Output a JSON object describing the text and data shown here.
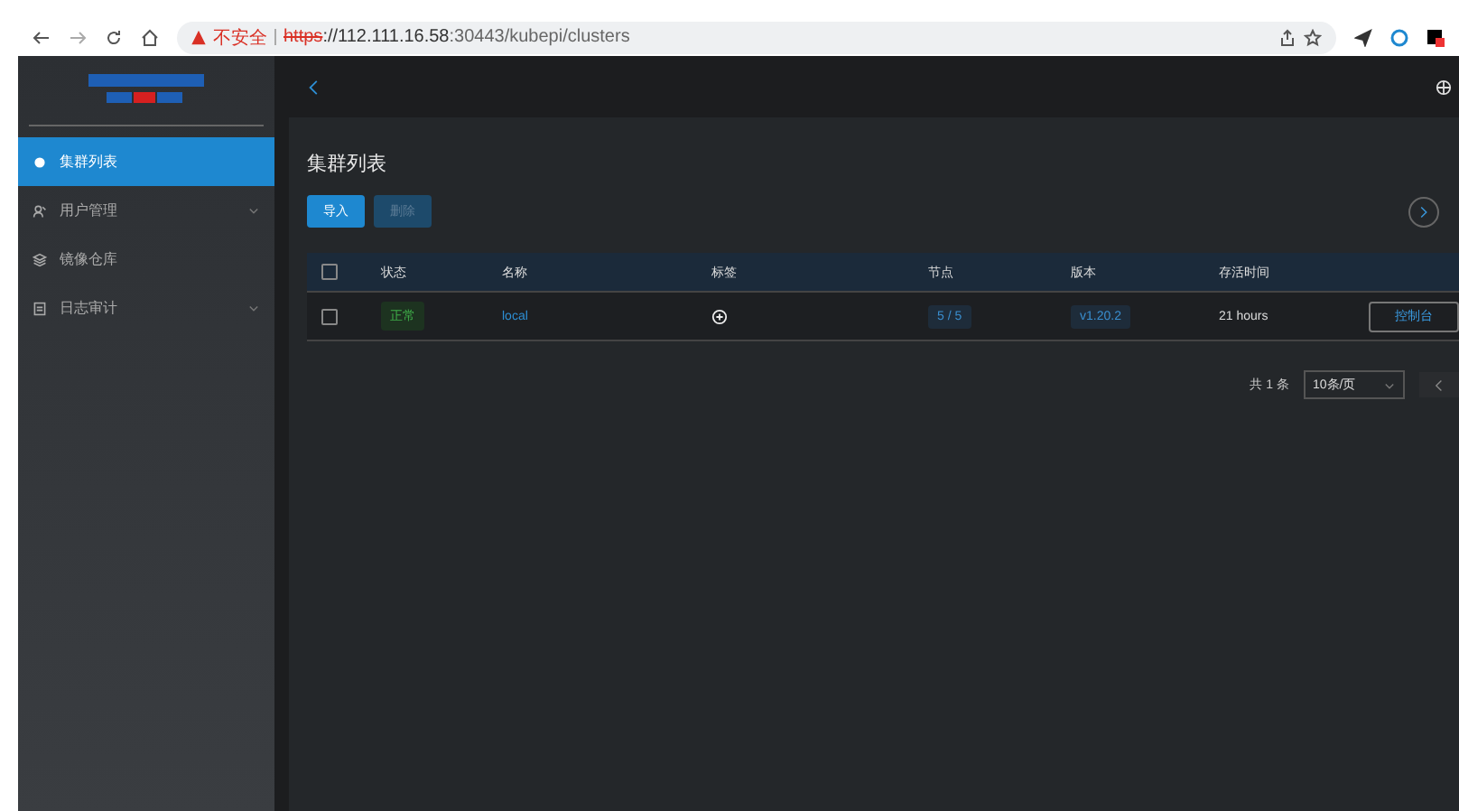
{
  "browser": {
    "security": "不安全",
    "url_scheme": "https",
    "url_host": "://112.111.16.58",
    "url_rest": ":30443/kubepi/clusters"
  },
  "sidebar": {
    "items": [
      {
        "label": "集群列表",
        "selected": true,
        "expandable": false
      },
      {
        "label": "用户管理",
        "selected": false,
        "expandable": true
      },
      {
        "label": "镜像仓库",
        "selected": false,
        "expandable": false
      },
      {
        "label": "日志审计",
        "selected": false,
        "expandable": true
      }
    ]
  },
  "page": {
    "title": "集群列表",
    "buttons": [
      {
        "label": "导入",
        "disabled": false
      },
      {
        "label": "删除",
        "disabled": true
      }
    ]
  },
  "table": {
    "all_checked": false,
    "columns": [
      "状态",
      "名称",
      "标签",
      "节点",
      "版本",
      "存活时间"
    ],
    "rows": [
      {
        "checked": false,
        "status": "正常",
        "name": "local",
        "nodes": "5 / 5",
        "version": "v1.20.2",
        "uptime": "21 hours",
        "action": "控制台"
      }
    ]
  },
  "pagination": {
    "total": "共 1 条",
    "page_size": "10条/页"
  }
}
